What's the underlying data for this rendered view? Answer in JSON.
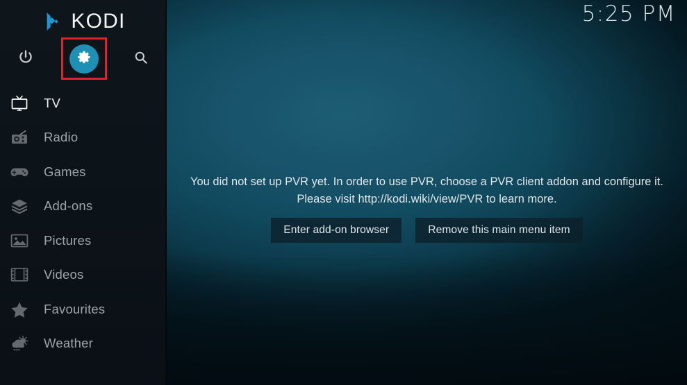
{
  "app": {
    "name": "KODI",
    "logo_icon": "kodi-logo-icon"
  },
  "clock": {
    "time": "5:25 PM"
  },
  "top_actions": [
    {
      "id": "power",
      "label": "Power",
      "icon": "power-icon"
    },
    {
      "id": "settings",
      "label": "Settings",
      "icon": "gear-icon",
      "highlighted": true,
      "accent": "#1e8fb5"
    },
    {
      "id": "search",
      "label": "Search",
      "icon": "search-icon"
    }
  ],
  "annotation": {
    "color": "#e02329",
    "target": "settings"
  },
  "sidebar": {
    "items": [
      {
        "label": "TV",
        "icon": "tv-icon",
        "active": true
      },
      {
        "label": "Radio",
        "icon": "radio-icon",
        "active": false
      },
      {
        "label": "Games",
        "icon": "gamepad-icon",
        "active": false
      },
      {
        "label": "Add-ons",
        "icon": "addons-box-icon",
        "active": false
      },
      {
        "label": "Pictures",
        "icon": "pictures-icon",
        "active": false
      },
      {
        "label": "Videos",
        "icon": "film-strip-icon",
        "active": false
      },
      {
        "label": "Favourites",
        "icon": "star-icon",
        "active": false
      },
      {
        "label": "Weather",
        "icon": "weather-icon",
        "active": false
      }
    ]
  },
  "main": {
    "message": "You did not set up PVR yet. In order to use PVR, choose a PVR client addon and configure it. Please visit http://kodi.wiki/view/PVR to learn more.",
    "buttons": [
      {
        "label": "Enter add-on browser"
      },
      {
        "label": "Remove this main menu item"
      }
    ]
  },
  "theme": {
    "sidebar_bg": "#0c1318",
    "accent_blue": "#1e8fb5",
    "annotation_red": "#e02329",
    "text_primary": "#eef2f4",
    "text_dim": "#9ea5a9"
  }
}
